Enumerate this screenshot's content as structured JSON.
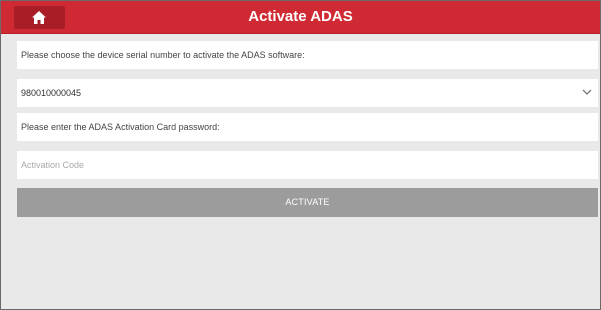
{
  "header": {
    "title": "Activate ADAS",
    "home_icon": "home-icon"
  },
  "form": {
    "serial_prompt": "Please choose the device serial number to activate the ADAS software:",
    "serial_selected": "980010000045",
    "serial_dropdown_icon": "chevron-down-icon",
    "password_prompt": "Please enter the ADAS Activation Card password:",
    "activation_code_placeholder": "Activation Code",
    "activation_code_value": "",
    "activate_label": "ACTIVATE"
  },
  "colors": {
    "header_background": "#cf2a34",
    "home_button_background": "#a91d26",
    "page_background": "#e9e9e9",
    "button_disabled": "#9c9c9c"
  }
}
